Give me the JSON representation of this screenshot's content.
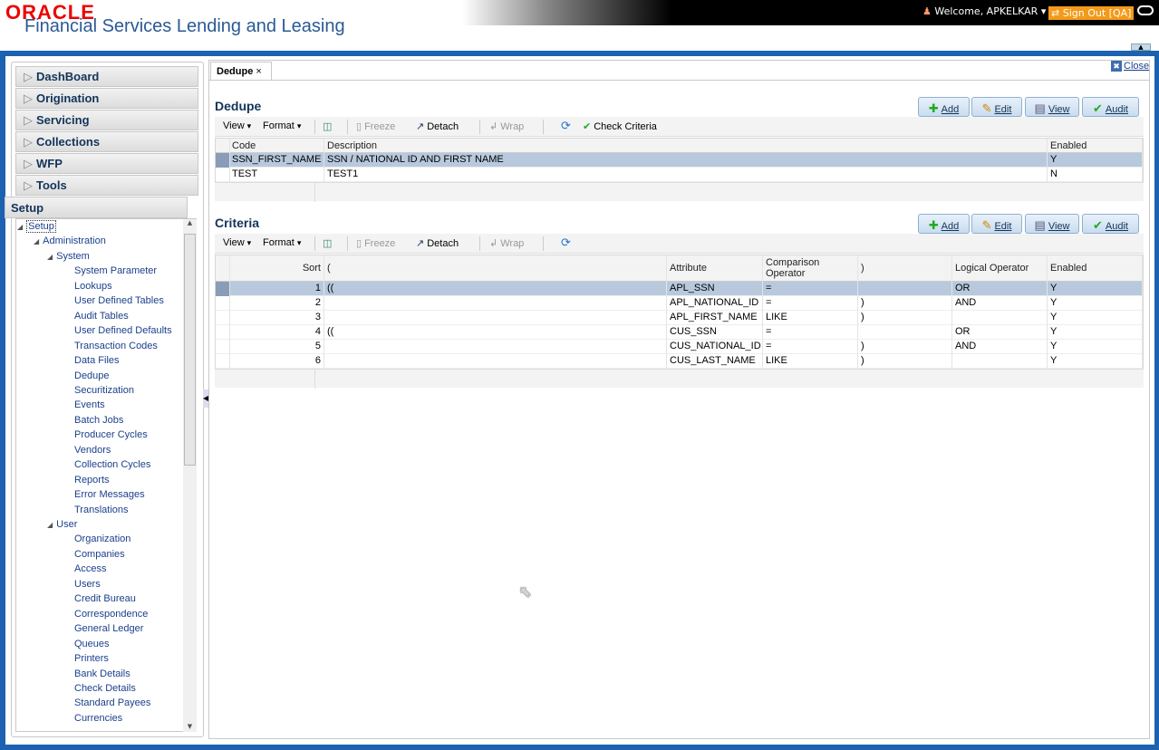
{
  "header": {
    "logo": "ORACLE",
    "app_name": "Financial Services Lending and Leasing",
    "welcome": "Welcome, APKELKAR",
    "sign_out": "Sign Out [QA]"
  },
  "sidebar": {
    "accordions": [
      "DashBoard",
      "Origination",
      "Servicing",
      "Collections",
      "WFP",
      "Tools"
    ],
    "setup_label": "Setup",
    "tree": [
      {
        "label": "Setup",
        "level": 0,
        "expanded": true,
        "selected": true
      },
      {
        "label": "Administration",
        "level": 1,
        "expanded": true
      },
      {
        "label": "System",
        "level": 2,
        "expanded": true
      },
      {
        "label": "System Parameter",
        "level": 3
      },
      {
        "label": "Lookups",
        "level": 3
      },
      {
        "label": "User Defined Tables",
        "level": 3
      },
      {
        "label": "Audit Tables",
        "level": 3
      },
      {
        "label": "User Defined Defaults",
        "level": 3
      },
      {
        "label": "Transaction Codes",
        "level": 3
      },
      {
        "label": "Data Files",
        "level": 3
      },
      {
        "label": "Dedupe",
        "level": 3
      },
      {
        "label": "Securitization",
        "level": 3
      },
      {
        "label": "Events",
        "level": 3
      },
      {
        "label": "Batch Jobs",
        "level": 3
      },
      {
        "label": "Producer Cycles",
        "level": 3
      },
      {
        "label": "Vendors",
        "level": 3
      },
      {
        "label": "Collection Cycles",
        "level": 3
      },
      {
        "label": "Reports",
        "level": 3
      },
      {
        "label": "Error Messages",
        "level": 3
      },
      {
        "label": "Translations",
        "level": 3
      },
      {
        "label": "User",
        "level": 2,
        "expanded": true
      },
      {
        "label": "Organization",
        "level": 3
      },
      {
        "label": "Companies",
        "level": 3
      },
      {
        "label": "Access",
        "level": 3
      },
      {
        "label": "Users",
        "level": 3
      },
      {
        "label": "Credit Bureau",
        "level": 3
      },
      {
        "label": "Correspondence",
        "level": 3
      },
      {
        "label": "General Ledger",
        "level": 3
      },
      {
        "label": "Queues",
        "level": 3
      },
      {
        "label": "Printers",
        "level": 3
      },
      {
        "label": "Bank Details",
        "level": 3
      },
      {
        "label": "Check Details",
        "level": 3
      },
      {
        "label": "Standard Payees",
        "level": 3
      },
      {
        "label": "Currencies",
        "level": 3
      }
    ]
  },
  "tab": {
    "label": "Dedupe",
    "close": "Close"
  },
  "buttons": {
    "add": "Add",
    "edit": "Edit",
    "view": "View",
    "audit": "Audit"
  },
  "toolbar": {
    "view": "View",
    "format": "Format",
    "freeze": "Freeze",
    "detach": "Detach",
    "wrap": "Wrap",
    "check_criteria": "Check Criteria"
  },
  "dedupe": {
    "title": "Dedupe",
    "columns": [
      "Code",
      "Description",
      "Enabled"
    ],
    "rows": [
      [
        "SSN_FIRST_NAME",
        "SSN / NATIONAL ID AND FIRST NAME",
        "Y"
      ],
      [
        "TEST",
        "TEST1",
        "N"
      ]
    ],
    "selected_row": 0
  },
  "criteria": {
    "title": "Criteria",
    "columns": [
      "Sort",
      "(",
      "Attribute",
      "Comparison Operator",
      ")",
      "Logical Operator",
      "Enabled"
    ],
    "rows": [
      [
        "1",
        "((",
        "APL_SSN",
        "=",
        "",
        "OR",
        "Y"
      ],
      [
        "2",
        "",
        "APL_NATIONAL_ID",
        "=",
        ")",
        "AND",
        "Y"
      ],
      [
        "3",
        "",
        "APL_FIRST_NAME",
        "LIKE",
        ")",
        "",
        "Y"
      ],
      [
        "4",
        "((",
        "CUS_SSN",
        "=",
        "",
        "OR",
        "Y"
      ],
      [
        "5",
        "",
        "CUS_NATIONAL_ID",
        "=",
        ")",
        "AND",
        "Y"
      ],
      [
        "6",
        "",
        "CUS_LAST_NAME",
        "LIKE",
        ")",
        "",
        "Y"
      ]
    ],
    "selected_row": 0
  },
  "colors": {
    "frame": "#1c62b0",
    "signout": "#f39a1a",
    "selected_row": "#b8c9de",
    "title": "#133459"
  }
}
